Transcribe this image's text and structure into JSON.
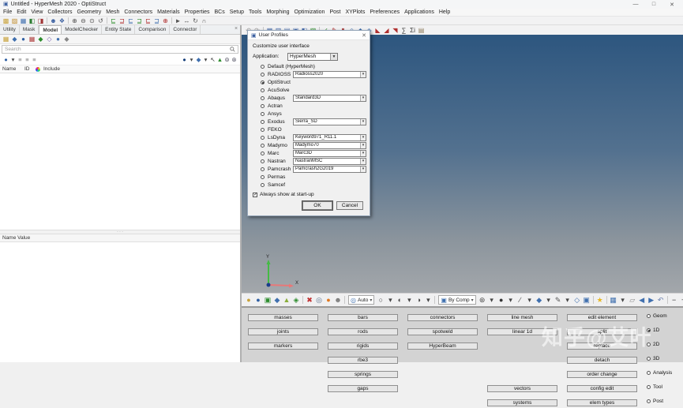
{
  "window": {
    "icon": "▣",
    "title": "Untitled - HyperMesh 2020 - OptiStruct",
    "minimize": "—",
    "maximize": "□",
    "close": "✕"
  },
  "menu": {
    "items": [
      "File",
      "Edit",
      "View",
      "Collectors",
      "Geometry",
      "Mesh",
      "Connectors",
      "Materials",
      "Properties",
      "BCs",
      "Setup",
      "Tools",
      "Morphing",
      "Optimization",
      "Post",
      "XYPlots",
      "Preferences",
      "Applications",
      "Help"
    ]
  },
  "toolbars": {
    "main": [
      {
        "n": "new-model-icon",
        "g": "▩",
        "c": "#c8a23a"
      },
      {
        "n": "open-model-icon",
        "g": "▨",
        "c": "#bf8b2a"
      },
      {
        "n": "save-model-icon",
        "g": "▦",
        "c": "#3f6fae"
      },
      {
        "n": "import-icon",
        "g": "◧",
        "c": "#2e7d32"
      },
      {
        "n": "export-icon",
        "g": "◨",
        "c": "#a03434"
      },
      {
        "n": "separator",
        "s": true
      },
      {
        "n": "user-profiles-icon",
        "g": "☻",
        "c": "#3a5fa0"
      },
      {
        "n": "session-icon",
        "g": "❖",
        "c": "#3a5fa0"
      },
      {
        "n": "separator",
        "s": true
      },
      {
        "n": "zoom-in-icon",
        "g": "⊕",
        "c": "#555555"
      },
      {
        "n": "zoom-out-icon",
        "g": "⊖",
        "c": "#555555"
      },
      {
        "n": "fit-view-icon",
        "g": "⊙",
        "c": "#555555"
      },
      {
        "n": "rotate-view-icon",
        "g": "↺",
        "c": "#555555"
      },
      {
        "n": "separator",
        "s": true
      },
      {
        "n": "mask-icon",
        "g": "⊑",
        "c": "#2c8c2c"
      },
      {
        "n": "unmask-icon",
        "g": "⊒",
        "c": "#b03030"
      },
      {
        "n": "mask-adjacent-icon",
        "g": "⊑",
        "c": "#3f6fae"
      },
      {
        "n": "unmask-adjacent-icon",
        "g": "⊒",
        "c": "#2c8c2c"
      },
      {
        "n": "reverse-mask-icon",
        "g": "⊑",
        "c": "#b03030"
      },
      {
        "n": "mask-all-icon",
        "g": "⊒",
        "c": "#3f6fae"
      },
      {
        "n": "spherical-clip-icon",
        "g": "⊕",
        "c": "#b03030"
      },
      {
        "n": "separator",
        "s": true
      },
      {
        "n": "select-arrow-icon",
        "g": "►",
        "c": "#555555"
      },
      {
        "n": "translate-icon",
        "g": "↔",
        "c": "#555555"
      },
      {
        "n": "rotate-icon",
        "g": "↻",
        "c": "#555555"
      },
      {
        "n": "arc-rotate-icon",
        "g": "∩",
        "c": "#555555"
      }
    ],
    "secondary": [
      {
        "n": "undo-icon",
        "g": "↶",
        "c": "#999999"
      },
      {
        "n": "redo-icon",
        "g": "↷",
        "c": "#999999"
      },
      {
        "n": "separator",
        "s": true
      },
      {
        "n": "window-layout-1-icon",
        "g": "▦",
        "c": "#4a6fae"
      },
      {
        "n": "window-layout-2-icon",
        "g": "▥",
        "c": "#4a6fae"
      },
      {
        "n": "window-layout-3-icon",
        "g": "▤",
        "c": "#4a6fae"
      },
      {
        "n": "window-layout-4-icon",
        "g": "▣",
        "c": "#4a6fae"
      },
      {
        "n": "window-layout-5-icon",
        "g": "◧",
        "c": "#4a6fae"
      },
      {
        "n": "expand-window-icon",
        "g": "▧",
        "c": "#2c8c2c"
      },
      {
        "n": "separator",
        "s": true
      },
      {
        "n": "measure-icon",
        "g": "✓",
        "c": "#2c8c2c"
      },
      {
        "n": "annotate-icon",
        "g": "✎",
        "c": "#b03030"
      },
      {
        "n": "cylinder-icon",
        "g": "▮",
        "c": "#b05050"
      },
      {
        "n": "iso-view-icon",
        "g": "◇",
        "c": "#3f6fae"
      },
      {
        "n": "iso-shaded-icon",
        "g": "◆",
        "c": "#3f6fae"
      },
      {
        "n": "iso-mixed-icon",
        "g": "◈",
        "c": "#3f6fae"
      },
      {
        "n": "weld-1-icon",
        "g": "◣",
        "c": "#b03030"
      },
      {
        "n": "weld-2-icon",
        "g": "◢",
        "c": "#b03030"
      },
      {
        "n": "weld-3-icon",
        "g": "◥",
        "c": "#b03030"
      },
      {
        "n": "sum-icon",
        "g": "∑",
        "c": "#333333"
      },
      {
        "n": "sum-i-icon",
        "g": "Σi",
        "c": "#333333"
      },
      {
        "n": "notebook-icon",
        "g": "▤",
        "c": "#8a7a5a"
      }
    ]
  },
  "browser": {
    "tabs": [
      {
        "name": "tab-utility",
        "label": "Utility",
        "active": false
      },
      {
        "name": "tab-mask",
        "label": "Mask",
        "active": false
      },
      {
        "name": "tab-model",
        "label": "Model",
        "active": true
      },
      {
        "name": "tab-modelchecker",
        "label": "ModelChecker",
        "active": false
      },
      {
        "name": "tab-entity-state",
        "label": "Entity State",
        "active": false
      },
      {
        "name": "tab-comparison",
        "label": "Comparison",
        "active": false
      },
      {
        "name": "tab-connector",
        "label": "Connector",
        "active": false
      }
    ],
    "close_icon": "×",
    "toolbar": [
      {
        "n": "entity-browser-icon",
        "g": "▦",
        "c": "#c8a23a"
      },
      {
        "n": "component-view-icon",
        "g": "◆",
        "c": "#3f6fae"
      },
      {
        "n": "assembly-view-icon",
        "g": "●",
        "c": "#2f5fa3"
      },
      {
        "n": "material-view-icon",
        "g": "▦",
        "c": "#b04040"
      },
      {
        "n": "property-view-icon",
        "g": "◆",
        "c": "#2c8c2c"
      },
      {
        "n": "load-view-icon",
        "g": "◇",
        "c": "#7a5fae"
      },
      {
        "n": "system-view-icon",
        "g": "●",
        "c": "#3f6fae"
      },
      {
        "n": "include-view-icon",
        "g": "◆",
        "c": "#888888"
      }
    ],
    "search_placeholder": "Search",
    "view_left": [
      {
        "n": "show-hide-icon",
        "g": "●",
        "c": "#2f5fa3"
      },
      {
        "n": "dropdown-arrow-icon",
        "g": "▾",
        "c": "#444444"
      },
      {
        "n": "list-state-1-icon",
        "g": "≡",
        "c": "#777777"
      },
      {
        "n": "list-state-2-icon",
        "g": "≡",
        "c": "#777777"
      },
      {
        "n": "list-state-3-icon",
        "g": "≡",
        "c": "#777777"
      }
    ],
    "view_right": [
      {
        "n": "display-sphere-icon",
        "g": "●",
        "c": "#123c78"
      },
      {
        "n": "dropdown-arrow-icon",
        "g": "▾",
        "c": "#444444"
      },
      {
        "n": "mask-sphere-icon",
        "g": "◆",
        "c": "#3f6fae"
      },
      {
        "n": "dropdown-arrow-icon",
        "g": "▾",
        "c": "#444444"
      },
      {
        "n": "pointer-icon",
        "g": "↖",
        "c": "#333333"
      },
      {
        "n": "isolate-icon",
        "g": "▲",
        "c": "#2c8c2c"
      },
      {
        "n": "glasses-icon",
        "g": "⊚",
        "c": "#555566"
      },
      {
        "n": "glasses-plus-icon",
        "g": "⊛",
        "c": "#555566"
      }
    ],
    "columns": {
      "name": "Name",
      "id": "ID",
      "include": "Include"
    },
    "splitter": "· · ·",
    "properties_header": "Name Value"
  },
  "dialog": {
    "icon": "▣",
    "title": "User Profiles",
    "close_icon": "✕",
    "heading": "Customize user interface",
    "application_label": "Application:",
    "application_value": "HyperMesh",
    "dropdown_button": "▼",
    "dropdown_arrow": "▾",
    "profiles": [
      {
        "label": "Default (HyperMesh)",
        "selected": false,
        "combo": ""
      },
      {
        "label": "RADIOSS",
        "selected": false,
        "combo": "Radioss2020"
      },
      {
        "label": "OptiStruct",
        "selected": true,
        "combo": ""
      },
      {
        "label": "AcuSolve",
        "selected": false,
        "combo": ""
      },
      {
        "label": "Abaqus",
        "selected": false,
        "combo": "Standard3D"
      },
      {
        "label": "Actran",
        "selected": false,
        "combo": ""
      },
      {
        "label": "Ansys",
        "selected": false,
        "combo": ""
      },
      {
        "label": "Exodus",
        "selected": false,
        "combo": "Sierra_SD"
      },
      {
        "label": "FEKO",
        "selected": false,
        "combo": ""
      },
      {
        "label": "LsDyna",
        "selected": false,
        "combo": "Keyword971_R11.1"
      },
      {
        "label": "Madymo",
        "selected": false,
        "combo": "Madymo70"
      },
      {
        "label": "Marc",
        "selected": false,
        "combo": "Marc3D"
      },
      {
        "label": "Nastran",
        "selected": false,
        "combo": "NastranMSC"
      },
      {
        "label": "Pamcrash",
        "selected": false,
        "combo": "Pamcrash2G2019"
      },
      {
        "label": "Permas",
        "selected": false,
        "combo": ""
      },
      {
        "label": "Samcef",
        "selected": false,
        "combo": ""
      }
    ],
    "checkbox_label": "Always show at start-up",
    "checkbox_checked": true,
    "ok_label": "OK",
    "cancel_label": "Cancel"
  },
  "viewport": {
    "axes": {
      "x": "X",
      "y": "Y"
    },
    "colors": {
      "top": "#2d567f",
      "bottom": "#a3a7ab"
    }
  },
  "bottom_toolbar": {
    "left": [
      {
        "n": "entity-sets-icon",
        "g": "●",
        "c": "#c8a23a"
      },
      {
        "n": "assemblies-icon",
        "g": "●",
        "c": "#2f5fa3"
      },
      {
        "n": "organize-icon",
        "g": "▣",
        "c": "#2c8c2c"
      },
      {
        "n": "renumber-icon",
        "g": "◆",
        "c": "#3f6fae"
      },
      {
        "n": "count-icon",
        "g": "▲",
        "c": "#8aae3a"
      },
      {
        "n": "mass-calc-icon",
        "g": "◈",
        "c": "#2c8c2c"
      },
      {
        "n": "separator",
        "s": true
      },
      {
        "n": "delete-icon",
        "g": "✖",
        "c": "#c03030"
      },
      {
        "n": "globe-icon",
        "g": "◎",
        "c": "#556b8a"
      },
      {
        "n": "temp-nodes-icon",
        "g": "●",
        "c": "#e07820"
      },
      {
        "n": "panels-icon",
        "g": "☻",
        "c": "#777777"
      },
      {
        "n": "separator",
        "s": true
      }
    ],
    "auto": {
      "label": "Auto",
      "icon": "◎"
    },
    "mid": [
      {
        "n": "wireframe-geometry-icon",
        "g": "○",
        "c": "#444444"
      },
      {
        "n": "dropdown-arrow-icon",
        "g": "▾",
        "c": "#444444"
      },
      {
        "n": "shaded-geometry-icon",
        "g": "◐",
        "c": "#444444"
      },
      {
        "n": "dropdown-arrow-icon",
        "g": "▾",
        "c": "#444444"
      },
      {
        "n": "topo-geometry-icon",
        "g": "◑",
        "c": "#444444"
      },
      {
        "n": "dropdown-arrow-icon",
        "g": "▾",
        "c": "#444444"
      },
      {
        "n": "separator",
        "s": true
      }
    ],
    "by_comp": {
      "label": "By Comp",
      "icon": "▣"
    },
    "tail": [
      {
        "n": "mesh-style-icon",
        "g": "⊛",
        "c": "#444444"
      },
      {
        "n": "dropdown-arrow-icon",
        "g": "▾",
        "c": "#444444"
      },
      {
        "n": "shaded-mesh-icon",
        "g": "●",
        "c": "#333333"
      },
      {
        "n": "dropdown-arrow-icon",
        "g": "▾",
        "c": "#444444"
      },
      {
        "n": "feature-lines-icon",
        "g": "∕",
        "c": "#444444"
      },
      {
        "n": "dropdown-arrow-icon",
        "g": "▾",
        "c": "#444444"
      },
      {
        "n": "thickness-icon",
        "g": "◆",
        "c": "#3f6fae"
      },
      {
        "n": "dropdown-arrow-icon",
        "g": "▾",
        "c": "#444444"
      },
      {
        "n": "element-handles-icon",
        "g": "✎",
        "c": "#555555"
      },
      {
        "n": "dropdown-arrow-icon",
        "g": "▾",
        "c": "#444444"
      },
      {
        "n": "duplicate-icon",
        "g": "◇",
        "c": "#3f6fae"
      },
      {
        "n": "monitor-icon",
        "g": "▣",
        "c": "#3f6fae"
      },
      {
        "n": "separator",
        "s": true
      },
      {
        "n": "favorites-star-icon",
        "g": "★",
        "c": "#e8b820"
      },
      {
        "n": "separator",
        "s": true
      },
      {
        "n": "grid-icon",
        "g": "▦",
        "c": "#3f6fae"
      },
      {
        "n": "dropdown-arrow-icon",
        "g": "▾",
        "c": "#444444"
      },
      {
        "n": "eraser-icon",
        "g": "▱",
        "c": "#888888"
      },
      {
        "n": "prev-page-icon",
        "g": "◀",
        "c": "#3f6fae"
      },
      {
        "n": "next-page-icon",
        "g": "▶",
        "c": "#3f6fae"
      },
      {
        "n": "undo-view-icon",
        "g": "↶",
        "c": "#6a7fae"
      },
      {
        "n": "separator",
        "s": true
      },
      {
        "n": "zoom-out-icon",
        "g": "−",
        "c": "#333333"
      },
      {
        "n": "zoom-in-icon",
        "g": "+",
        "c": "#333333"
      },
      {
        "n": "redo-view-icon",
        "g": "↷",
        "c": "#6a7fae"
      }
    ]
  },
  "panel_menu": {
    "rows": [
      {
        "c": [
          "masses",
          "bars",
          "connectors",
          "line mesh",
          "edit element"
        ],
        "page": "Geom",
        "sel": false
      },
      {
        "c": [
          "joints",
          "rods",
          "spotweld",
          "linear 1d",
          "split"
        ],
        "page": "1D",
        "sel": true
      },
      {
        "c": [
          "markers",
          "rigids",
          "HyperBeam",
          "",
          "replace"
        ],
        "page": "2D",
        "sel": false
      },
      {
        "c": [
          "",
          "rbe3",
          "",
          "",
          "detach"
        ],
        "page": "3D",
        "sel": false
      },
      {
        "c": [
          "",
          "springs",
          "",
          "",
          "order change"
        ],
        "page": "Analysis",
        "sel": false
      },
      {
        "c": [
          "",
          "gaps",
          "",
          "vectors",
          "config edit"
        ],
        "page": "Tool",
        "sel": false
      },
      {
        "c": [
          "",
          "",
          "",
          "systems",
          "elem types"
        ],
        "page": "Post",
        "sel": false
      }
    ]
  },
  "watermark": "知乎@艾叶"
}
